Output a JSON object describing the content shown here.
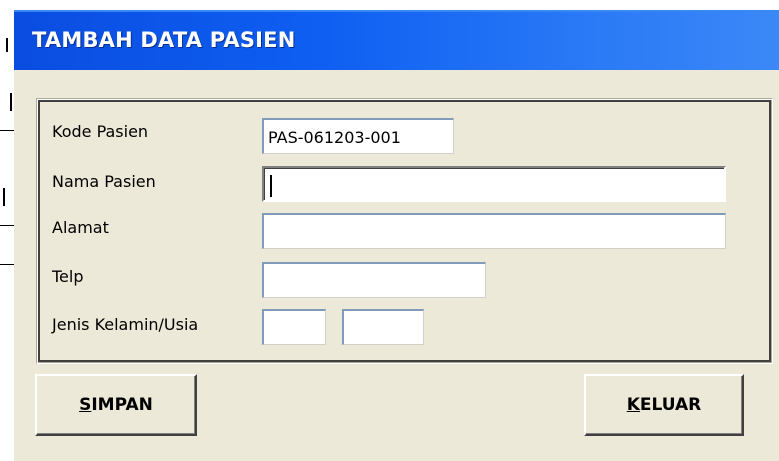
{
  "window": {
    "title": "TAMBAH DATA PASIEN"
  },
  "form": {
    "kode_pasien": {
      "label": "Kode Pasien",
      "value": "PAS-061203-001"
    },
    "nama_pasien": {
      "label": "Nama Pasien",
      "value": ""
    },
    "alamat": {
      "label": "Alamat",
      "value": ""
    },
    "telp": {
      "label": "Telp",
      "value": ""
    },
    "jenis_kelamin_usia": {
      "label": "Jenis Kelamin/Usia",
      "jenis_kelamin_value": "",
      "usia_value": ""
    }
  },
  "buttons": {
    "simpan_label": "SIMPAN",
    "keluar_label": "KELUAR"
  },
  "colors": {
    "titlebar_start": "#0a4de0",
    "titlebar_end": "#3b88f7",
    "window_face": "#ece9d8",
    "title_text": "#ffffff"
  }
}
